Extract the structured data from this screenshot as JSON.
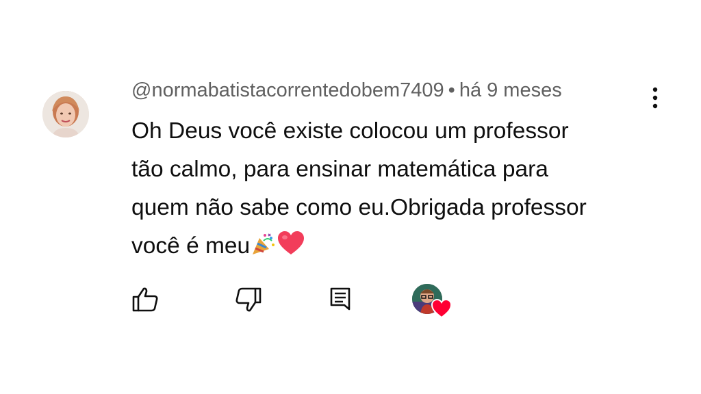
{
  "comment": {
    "author": "@normabatistacorrentedobem7409",
    "separator": "•",
    "timestamp": "há 9 meses",
    "text_lines": [
      "Oh Deus você existe colocou um professor",
      "tão calmo, para ensinar matemática para",
      "quem não sabe como eu.Obrigada professor",
      "você é meu"
    ],
    "emojis": [
      "party-popper",
      "red-heart"
    ],
    "avatar": "user-avatar-photo"
  },
  "actions": {
    "like_icon": "thumbs-up-icon",
    "dislike_icon": "thumbs-down-icon",
    "reply_icon": "reply-comment-icon",
    "creator_heart": "creator-heart-badge"
  },
  "colors": {
    "meta": "#606060",
    "text": "#0f0f0f",
    "heart": "#ff0033"
  }
}
